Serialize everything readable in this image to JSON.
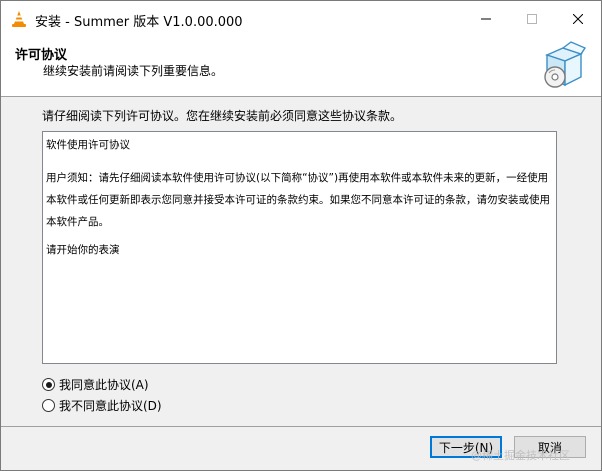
{
  "window": {
    "title": "安装 - Summer 版本 V1.0.00.000"
  },
  "header": {
    "title": "许可协议",
    "subtitle": "继续安装前请阅读下列重要信息。"
  },
  "instruction": "请仔细阅读下列许可协议。您在继续安装前必须同意这些协议条款。",
  "license": {
    "heading": "软件使用许可协议",
    "paragraph": "用户须知：请先仔细阅读本软件使用许可协议(以下简称“协议”)再使用本软件或本软件未来的更新，一经使用本软件或任何更新即表示您同意并接受本许可证的条款约束。如果您不同意本许可证的条款，请勿安装或使用本软件产品。",
    "closing": "请开始你的表演"
  },
  "options": {
    "accept": "我同意此协议(A)",
    "decline": "我不同意此协议(D)",
    "selected": "accept"
  },
  "buttons": {
    "next": "下一步(N)",
    "cancel": "取消"
  },
  "watermark": "@稀土掘金技术社区",
  "icons": {
    "app": "vlc-cone-icon",
    "header": "software-box-icon"
  }
}
